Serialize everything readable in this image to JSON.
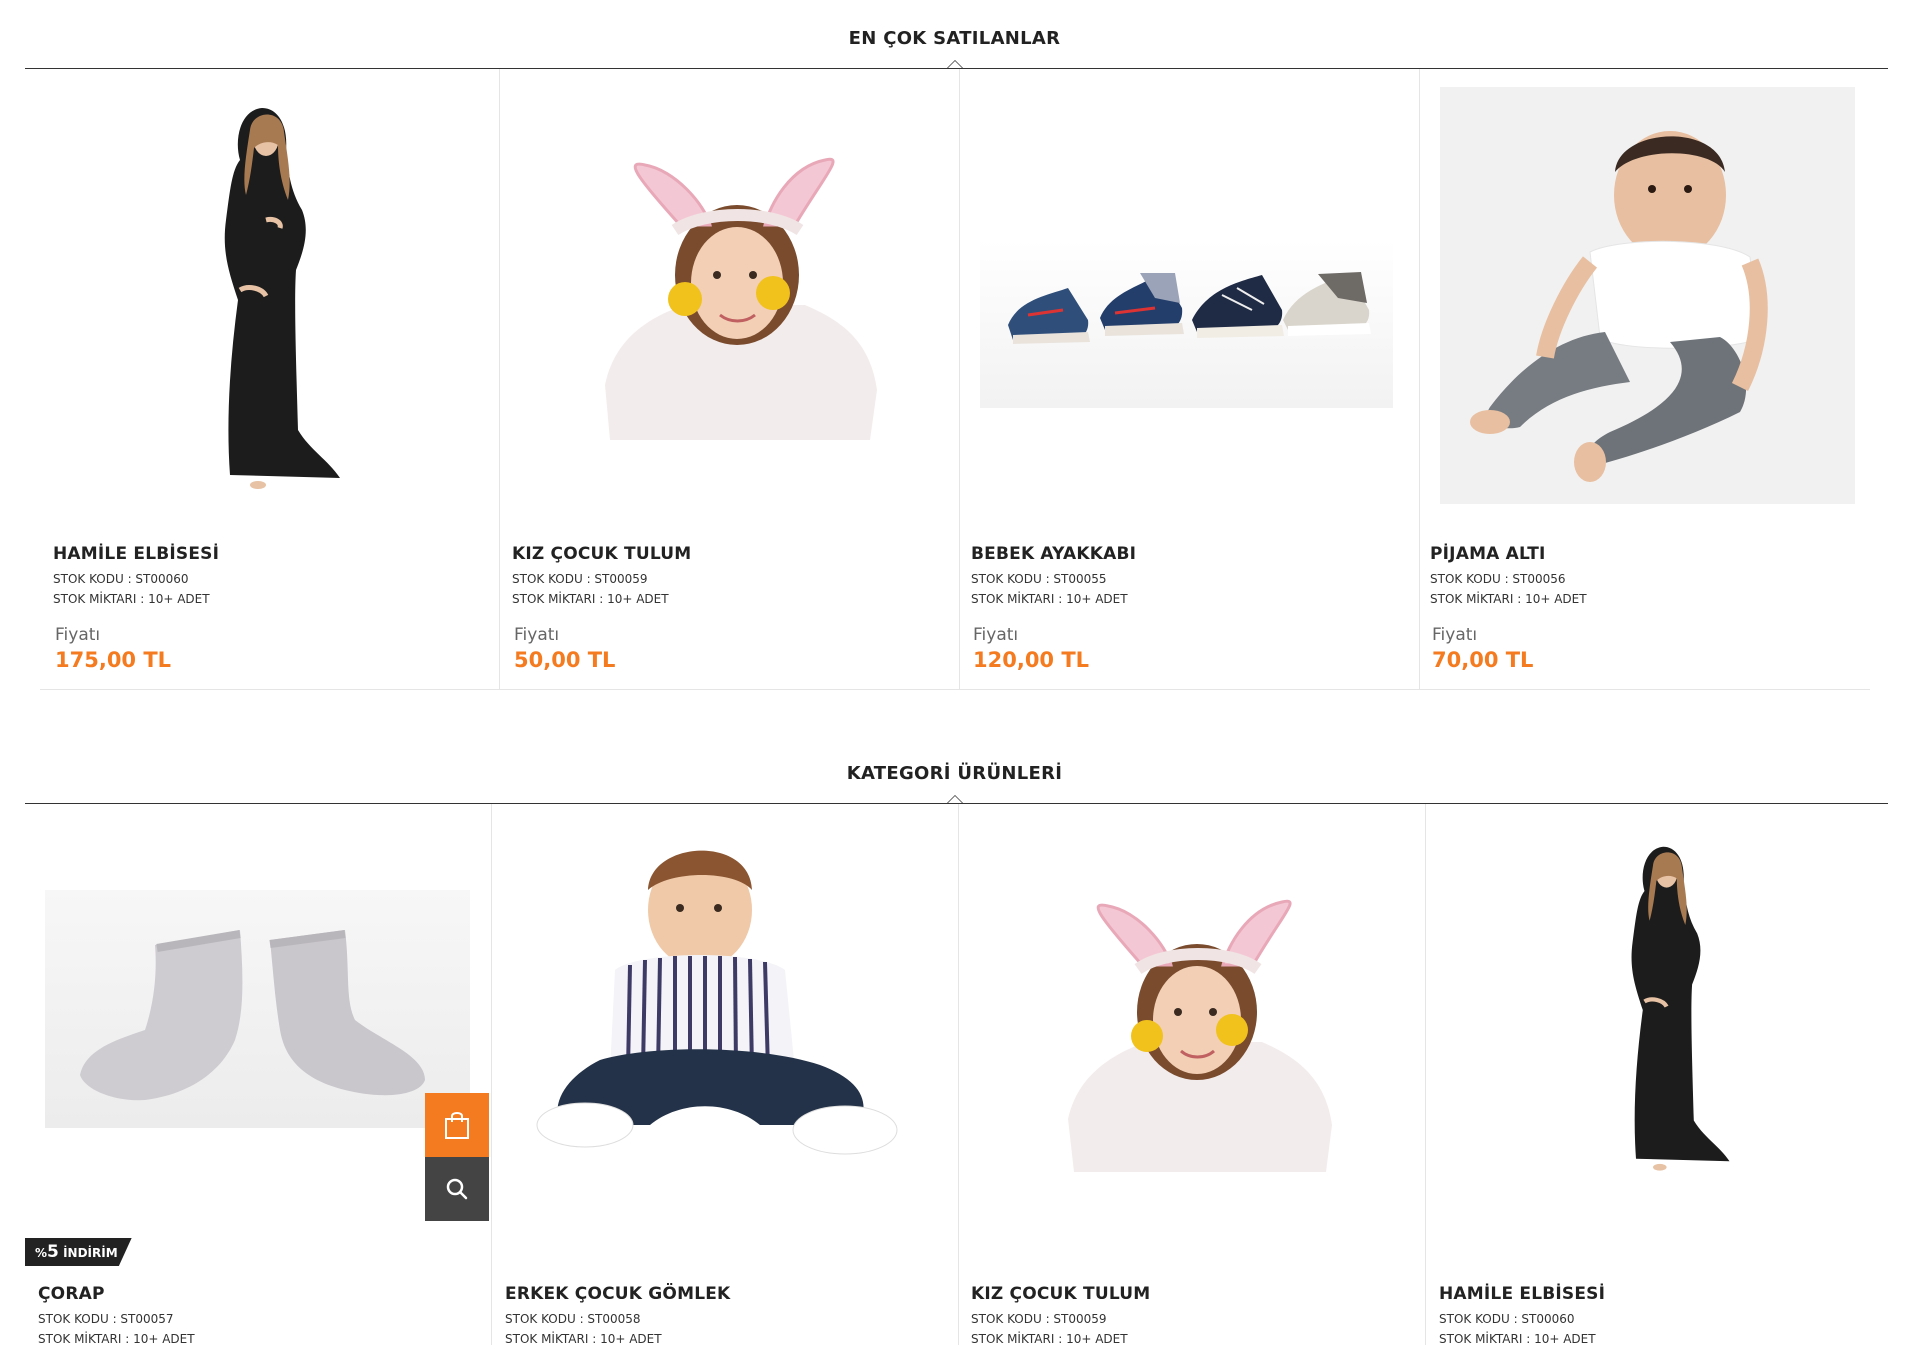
{
  "best_sellers": {
    "title": "EN ÇOK SATILANLAR",
    "products": [
      {
        "name": "HAMİLE ELBİSESİ",
        "stock_code": "STOK KODU : ST00060",
        "stock_qty": "STOK MİKTARI : 10+ ADET",
        "price_label": "Fiyatı",
        "price": "175,00 TL",
        "image": "pregnant-woman-black-dress"
      },
      {
        "name": "KIZ ÇOCUK TULUM",
        "stock_code": "STOK KODU : ST00059",
        "stock_qty": "STOK MİKTARI : 10+ ADET",
        "price_label": "Fiyatı",
        "price": "50,00 TL",
        "image": "girl-bunny-ears"
      },
      {
        "name": "BEBEK AYAKKABI",
        "stock_code": "STOK KODU : ST00055",
        "stock_qty": "STOK MİKTARI : 10+ ADET",
        "price_label": "Fiyatı",
        "price": "120,00 TL",
        "image": "baby-shoes"
      },
      {
        "name": "PİJAMA ALTI",
        "stock_code": "STOK KODU : ST00056",
        "stock_qty": "STOK MİKTARI : 10+ ADET",
        "price_label": "Fiyatı",
        "price": "70,00 TL",
        "image": "baby-grey-pants"
      }
    ]
  },
  "category_products": {
    "title": "KATEGORİ ÜRÜNLERİ",
    "products": [
      {
        "name": "ÇORAP",
        "stock_code": "STOK KODU : ST00057",
        "stock_qty": "STOK MİKTARI : 10+ ADET",
        "image": "grey-baby-socks",
        "badge_prefix": "%",
        "badge_value": "5",
        "badge_text": "İNDİRİM"
      },
      {
        "name": "ERKEK ÇOCUK GÖMLEK",
        "stock_code": "STOK KODU : ST00058",
        "stock_qty": "STOK MİKTARI : 10+ ADET",
        "image": "boy-striped-shirt"
      },
      {
        "name": "KIZ ÇOCUK TULUM",
        "stock_code": "STOK KODU : ST00059",
        "stock_qty": "STOK MİKTARI : 10+ ADET",
        "image": "girl-bunny-ears"
      },
      {
        "name": "HAMİLE ELBİSESİ",
        "stock_code": "STOK KODU : ST00060",
        "stock_qty": "STOK MİKTARI : 10+ ADET",
        "image": "pregnant-woman-black-dress"
      }
    ]
  },
  "icons": {
    "add_to_cart": "shopping-bag-icon",
    "quick_view": "search-icon"
  },
  "colors": {
    "accent": "#f47b20",
    "dark_button": "#444444",
    "badge": "#222222"
  }
}
